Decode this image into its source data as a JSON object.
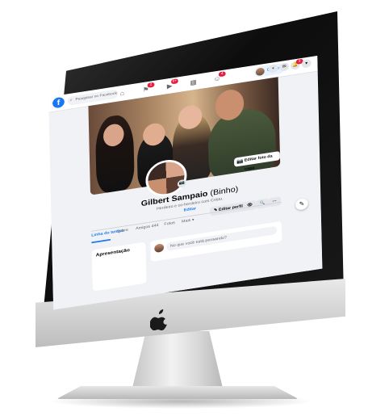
{
  "app": {
    "brand_icon": "facebook-logo-icon"
  },
  "topbar": {
    "search_placeholder": "Pesquisar no Facebook",
    "nav_icons": [
      {
        "name": "home-icon",
        "glyph": "⌂",
        "badge": ""
      },
      {
        "name": "flag-icon",
        "glyph": "⚑",
        "badge": "2"
      },
      {
        "name": "watch-icon",
        "glyph": "▶",
        "badge": "9+"
      },
      {
        "name": "marketplace-icon",
        "glyph": "▦",
        "badge": ""
      },
      {
        "name": "groups-icon",
        "glyph": "☺",
        "badge": "4"
      }
    ],
    "profile_name": "Gilbert",
    "round_buttons": [
      {
        "name": "plus-icon",
        "glyph": "+",
        "badge": ""
      },
      {
        "name": "messenger-icon",
        "glyph": "✉",
        "badge": ""
      },
      {
        "name": "bell-icon",
        "glyph": "🔔",
        "badge": "2"
      },
      {
        "name": "chevron-down-icon",
        "glyph": "▾",
        "badge": ""
      }
    ]
  },
  "cover": {
    "edit_label": "Editar foto da capa"
  },
  "profile": {
    "name": "Gilbert Sampaio",
    "alt_name": "(Binho)",
    "bio": "Herdeiro e co-herdeiro com Cristo.",
    "edit_link": "Editar"
  },
  "actions": {
    "edit_profile": "Editar perfil",
    "view": "👁",
    "search": "🔍",
    "more": "···"
  },
  "tabs": [
    "Linha do tempo",
    "Sobre",
    "Amigos 444",
    "Fotos",
    "Mais ▾"
  ],
  "left_card": {
    "title": "Apresentação"
  },
  "composer": {
    "placeholder": "No que você está pensando?"
  }
}
